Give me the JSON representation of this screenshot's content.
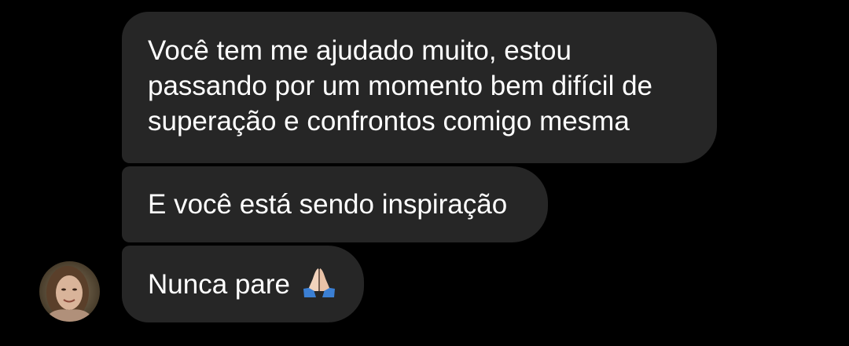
{
  "messages": [
    {
      "lines": [
        "Você tem me ajudado muito, estou",
        "passando por um momento bem difícil de",
        "superação e confrontos comigo mesma"
      ]
    },
    {
      "text": "E você está sendo inspiração"
    },
    {
      "text": "Nunca pare",
      "emoji": "folded-hands-icon"
    }
  ],
  "colors": {
    "background": "#000000",
    "bubble": "#262626",
    "text": "#ffffff"
  }
}
